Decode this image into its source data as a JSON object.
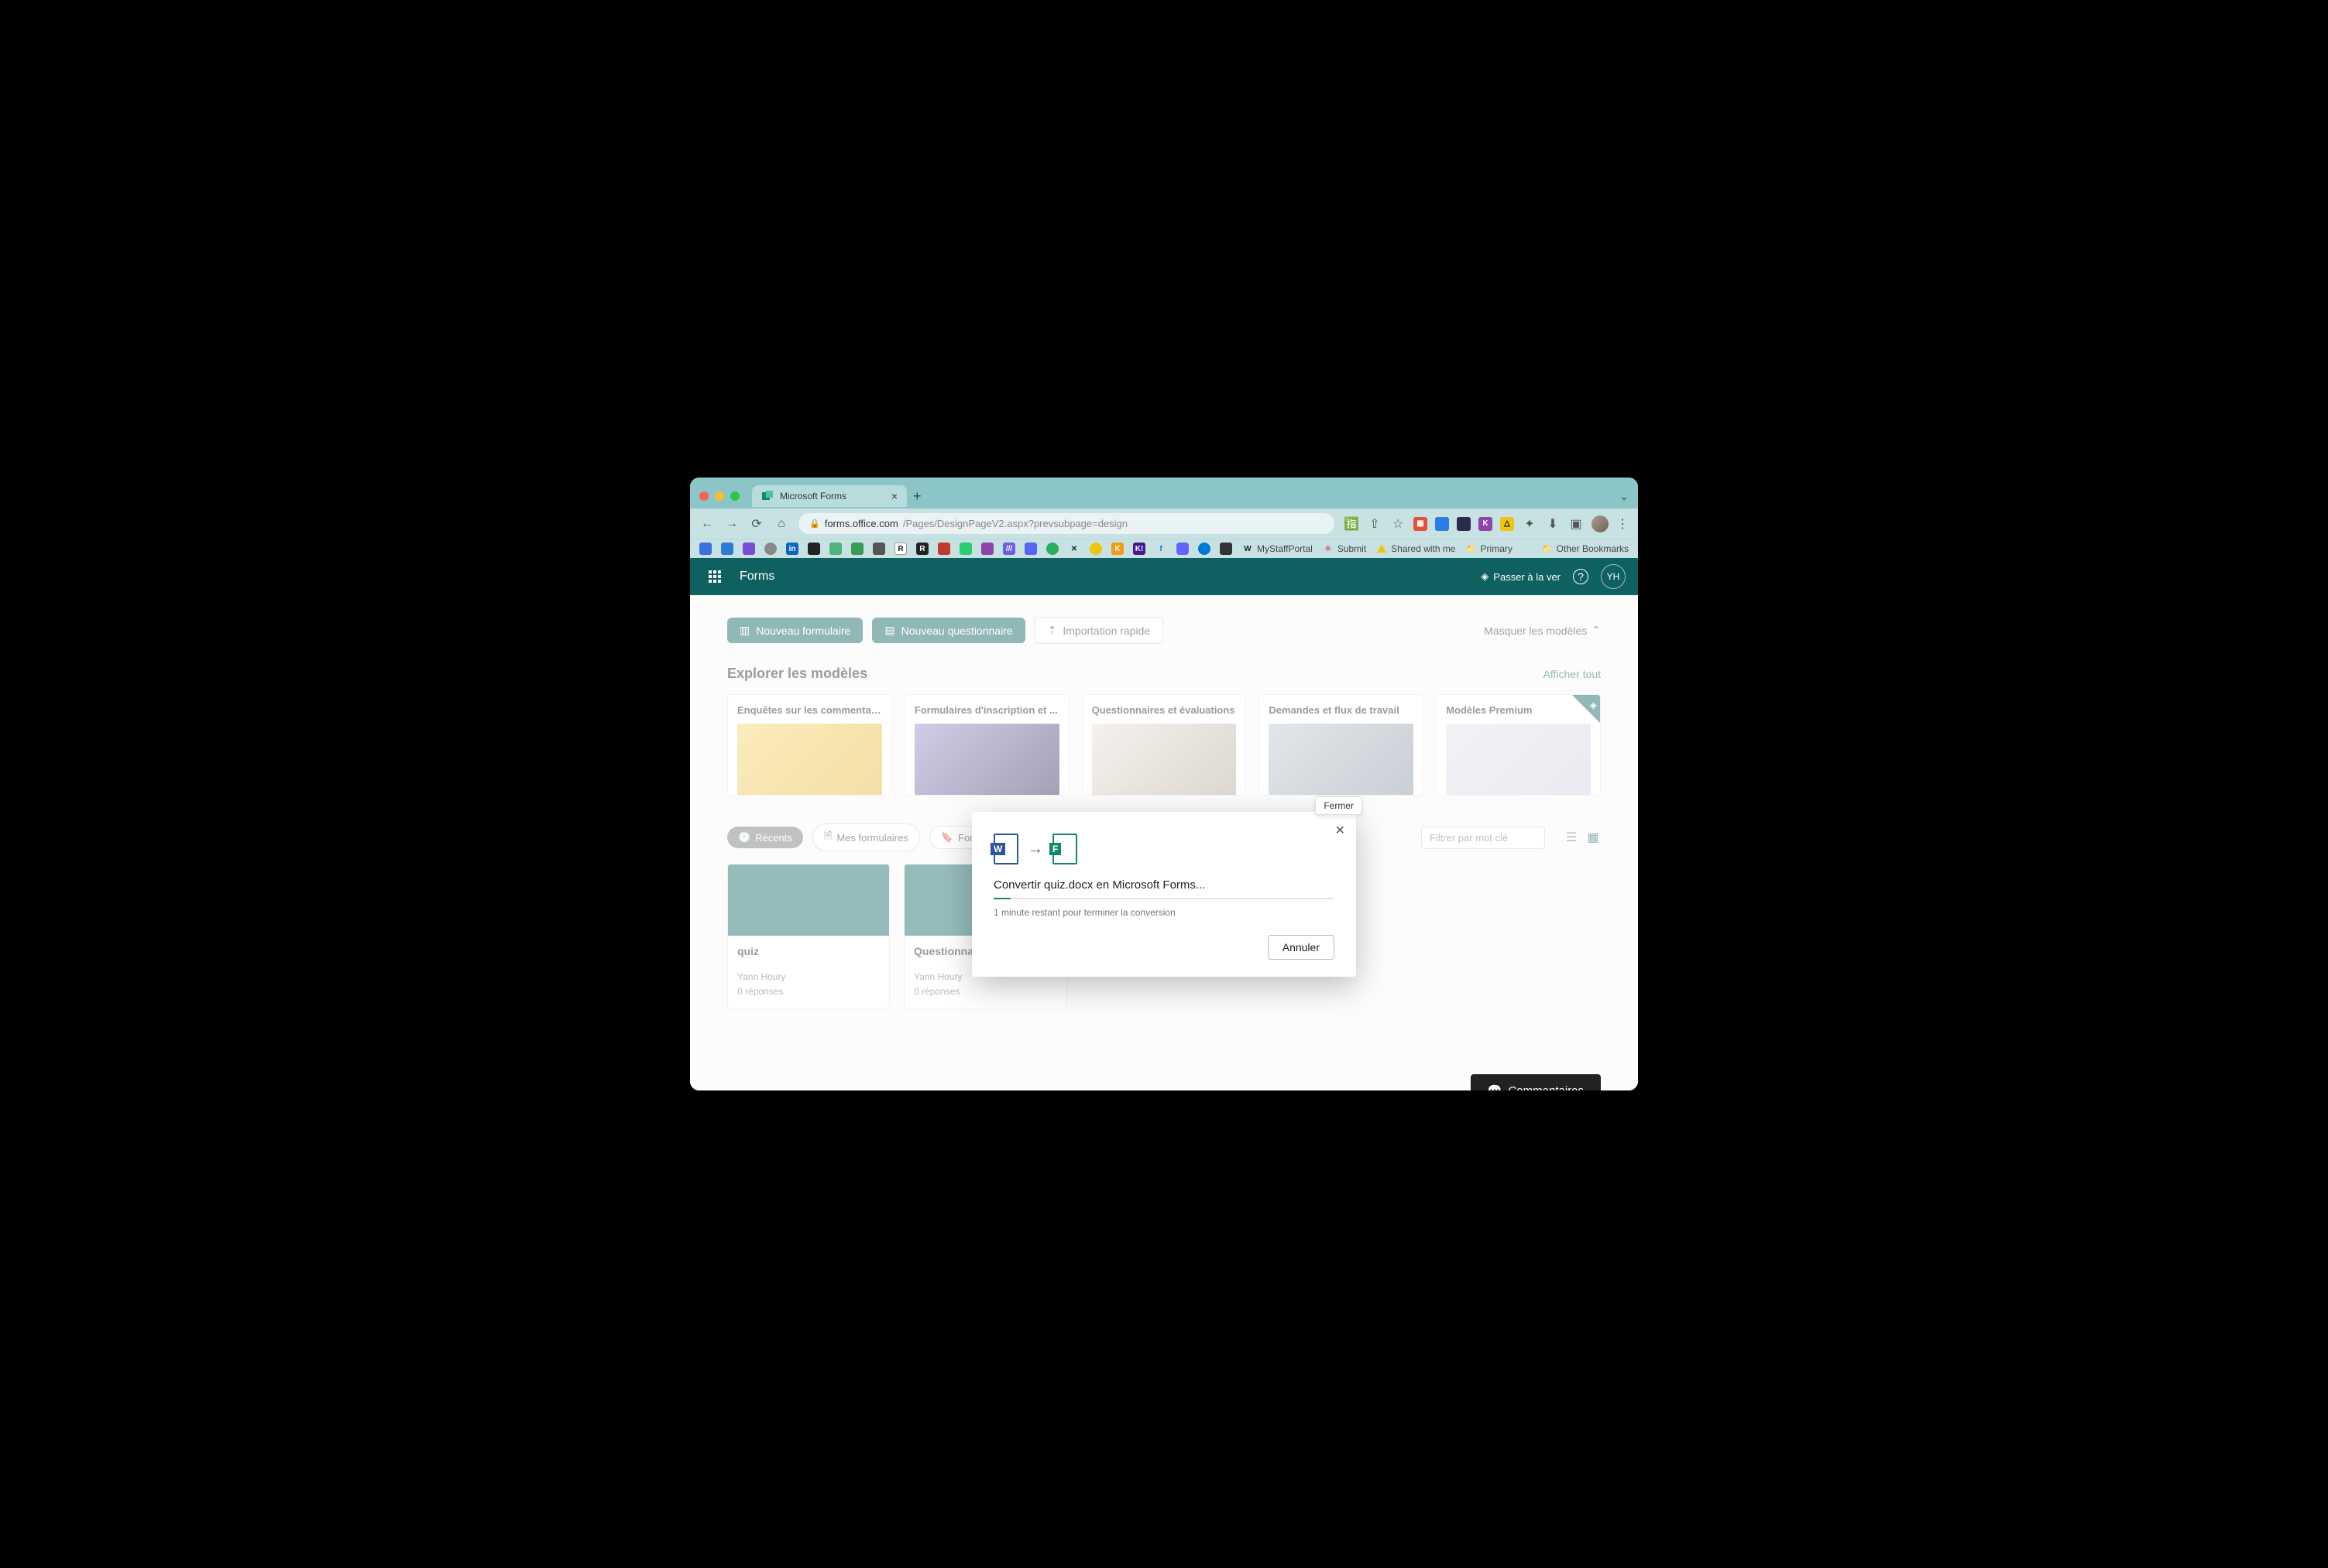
{
  "browser": {
    "tab_title": "Microsoft Forms",
    "url_host": "forms.office.com",
    "url_path": "/Pages/DesignPageV2.aspx?prevsubpage=design",
    "bookmarks_named": [
      "MyStaffPortal",
      "Submit",
      "Shared with me",
      "Primary",
      "Other Bookmarks"
    ]
  },
  "header": {
    "app_name": "Forms",
    "premium_label": "Passer à la ver",
    "user_initials": "YH"
  },
  "actions": {
    "new_form": "Nouveau formulaire",
    "new_quiz": "Nouveau questionnaire",
    "quick_import": "Importation rapide",
    "hide_templates": "Masquer les modèles"
  },
  "templates": {
    "section_title": "Explorer les modèles",
    "view_all": "Afficher tout",
    "cards": [
      "Enquêtes sur les commentair...",
      "Formulaires d'inscription et ...",
      "Questionnaires et évaluations",
      "Demandes et flux de travail",
      "Modèles Premium"
    ]
  },
  "filters": {
    "recent": "Récents",
    "my_forms": "Mes formulaires",
    "form": "Formul...",
    "search_placeholder": "Filtrer par mot clé"
  },
  "forms": [
    {
      "title": "quiz",
      "owner": "Yann Houry",
      "responses": "0 réponses"
    },
    {
      "title": "Questionnaire sans titre",
      "owner": "Yann Houry",
      "responses": "0 réponses"
    }
  ],
  "modal": {
    "close_tooltip": "Fermer",
    "title": "Convertir quiz.docx en Microsoft Forms...",
    "subtitle": "1 minute restant pour terminer la conversion",
    "cancel": "Annuler"
  },
  "footer": {
    "comments": "Commentaires"
  }
}
